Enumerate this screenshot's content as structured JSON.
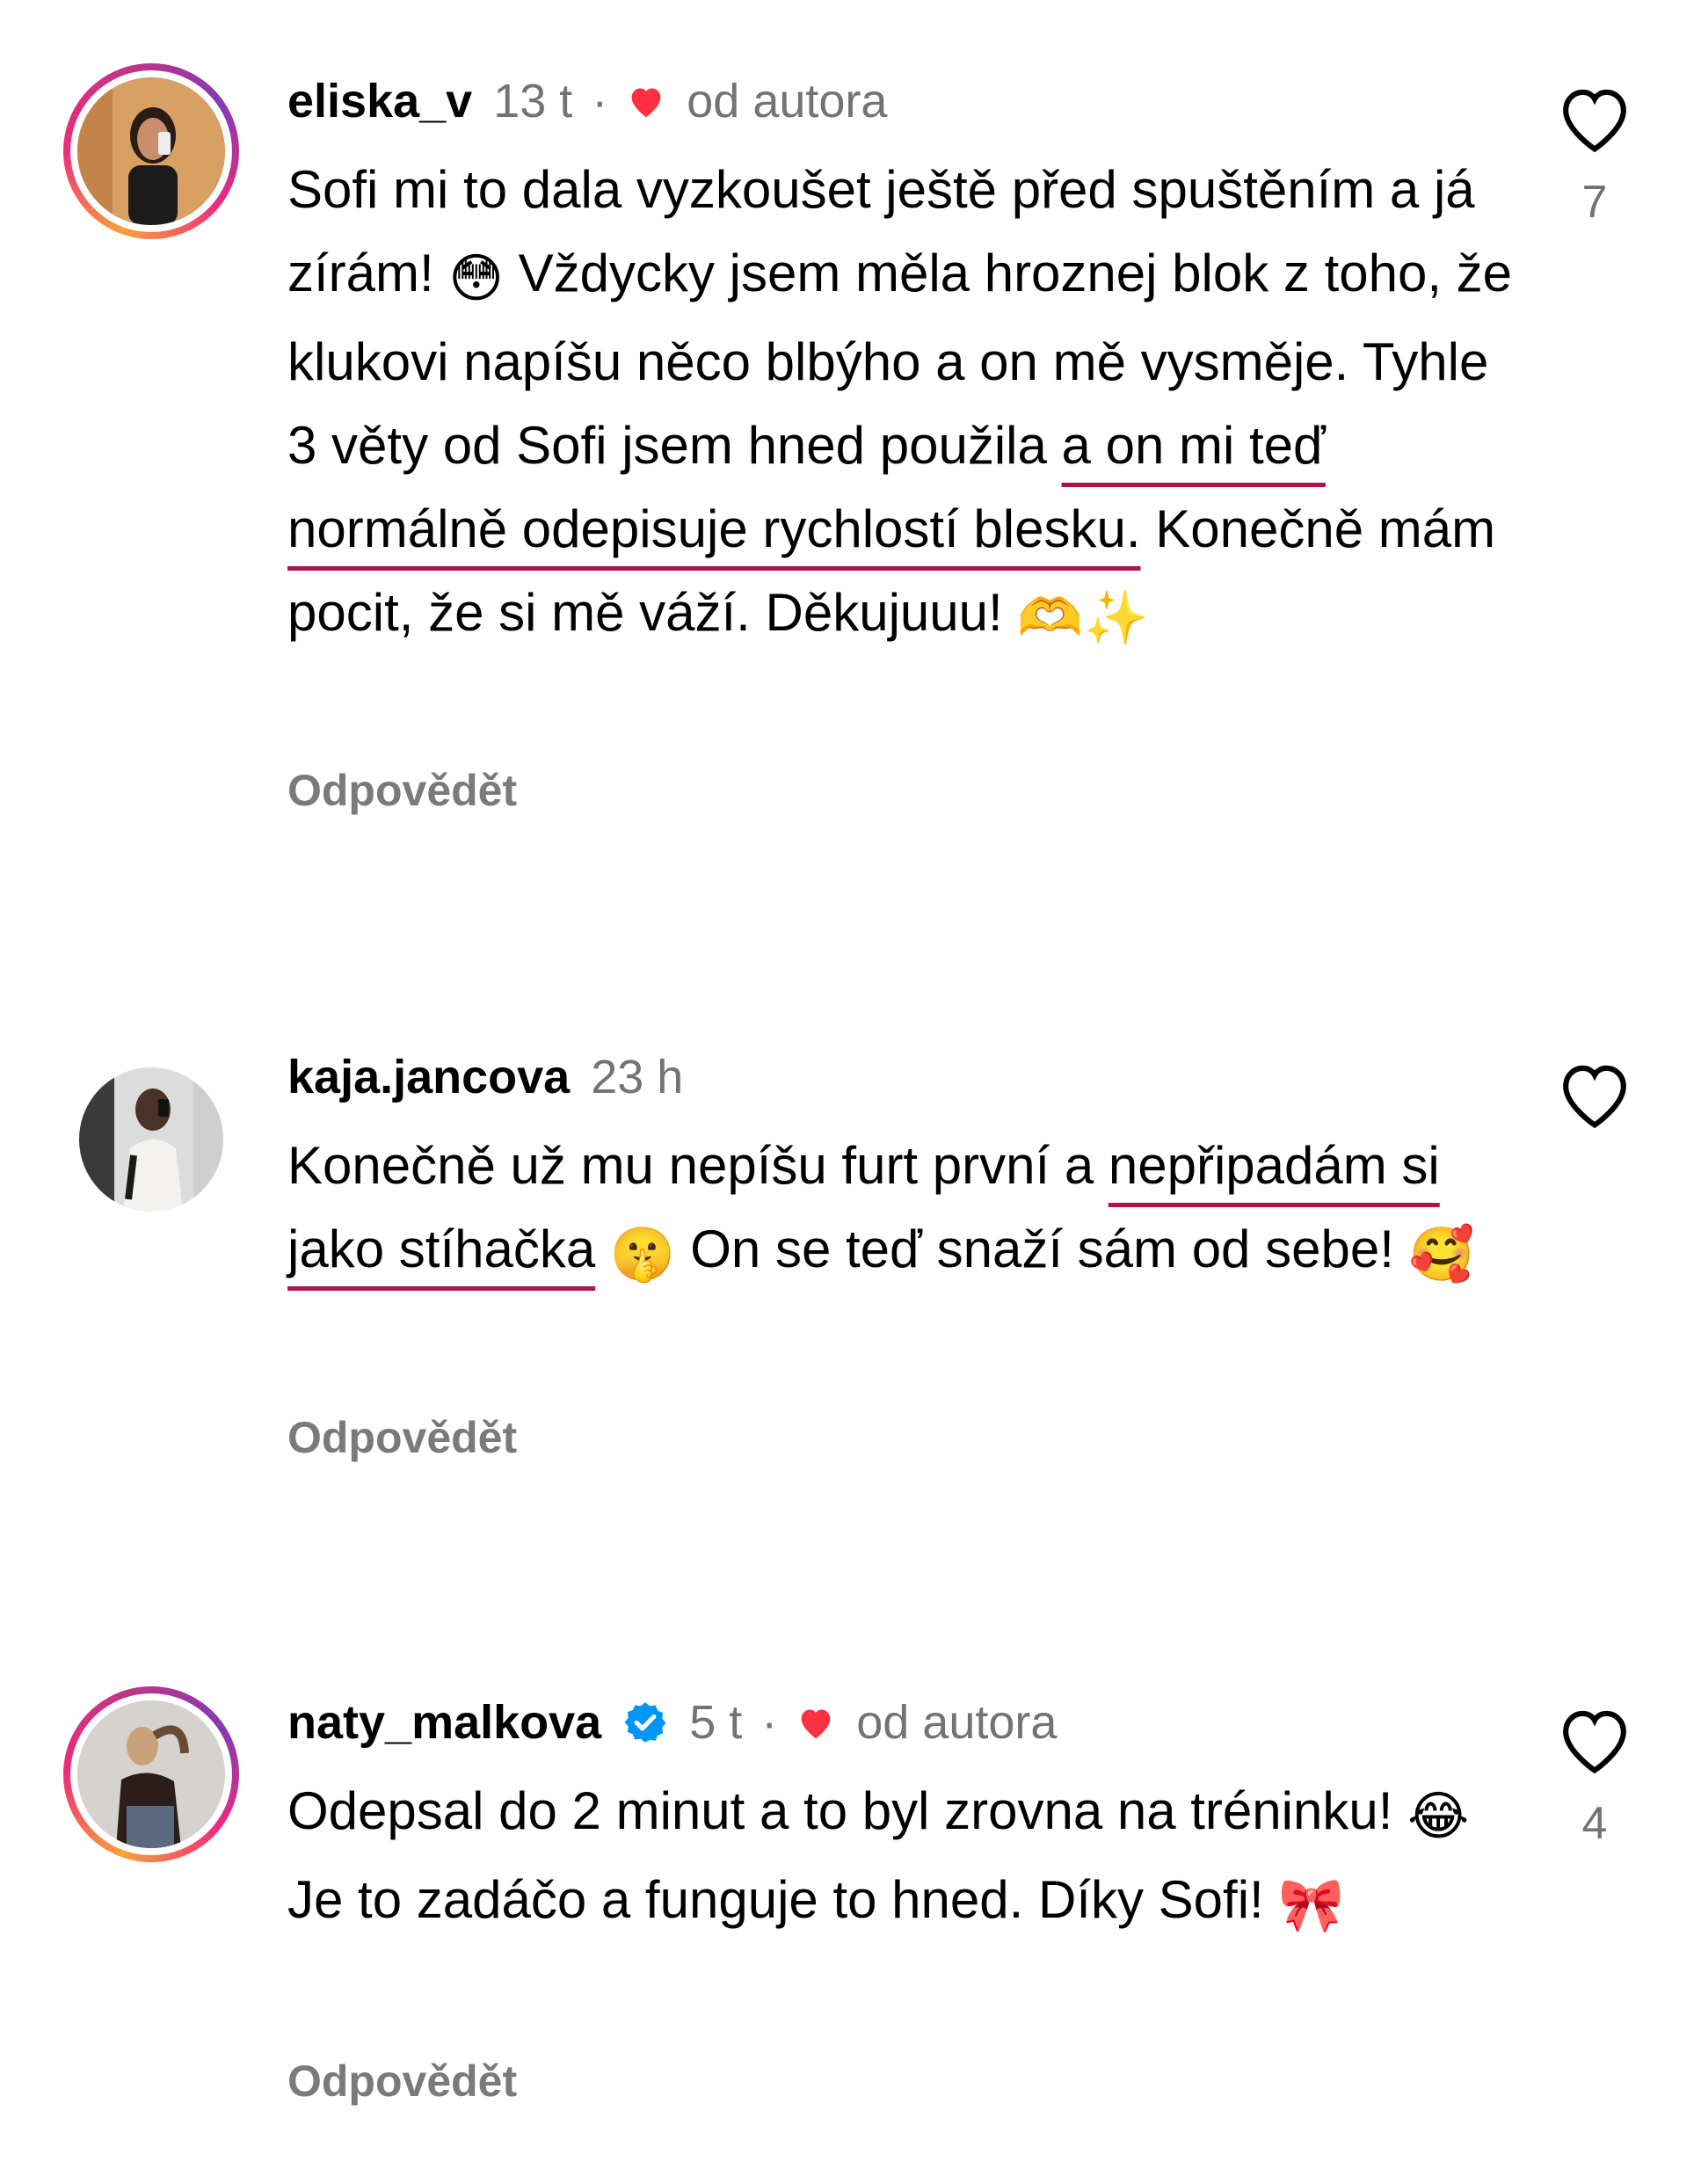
{
  "comments": [
    {
      "username": "eliska_v",
      "time": "13 t",
      "separator": "·",
      "author_tag": "od autora",
      "text_before": "Sofi mi to dala vyzkoušet ještě před spuštěním a já zírám! ",
      "emoji_1": "😳",
      "text_mid": " Vždycky jsem měla hroznej blok z toho, že klukovi napíšu něco blbýho a on mě vysměje. Tyhle 3 věty od Sofi jsem hned použila ",
      "highlight": "a on mi teď normálně odepisuje rychlostí blesku.",
      "text_after": " Konečně mám pocit, že si mě váží. Děkujuuu! ",
      "emoji_2": "🫶✨",
      "reply_label": "Odpovědět",
      "like_count": "7"
    },
    {
      "username": "kaja.jancova",
      "time": "23 h",
      "text_before": "Konečně už mu nepíšu furt první a ",
      "highlight": "nepřipadám si jako stíhačka",
      "emoji_1": "🤫",
      "text_after": " On se teď snaží sám od sebe! ",
      "emoji_2": "🥰",
      "reply_label": "Odpovědět"
    },
    {
      "username": "naty_malkova",
      "time": "5 t",
      "separator": "·",
      "author_tag": "od autora",
      "text_before": "Odepsal do 2 minut a to byl zrovna na tréninku! ",
      "emoji_1": "😂",
      "text_after": " Je to zadáčo a funguje to hned. Díky Sofi! ",
      "emoji_2": "🎀",
      "reply_label": "Odpovědět",
      "like_count": "4"
    }
  ],
  "colors": {
    "heart_red": "#ff3040",
    "underline": "#b0124f",
    "muted_text": "#737373",
    "verified_blue": "#0095f6"
  },
  "icons": [
    "heart-outline-icon",
    "heart-filled-icon",
    "verified-badge-icon"
  ]
}
